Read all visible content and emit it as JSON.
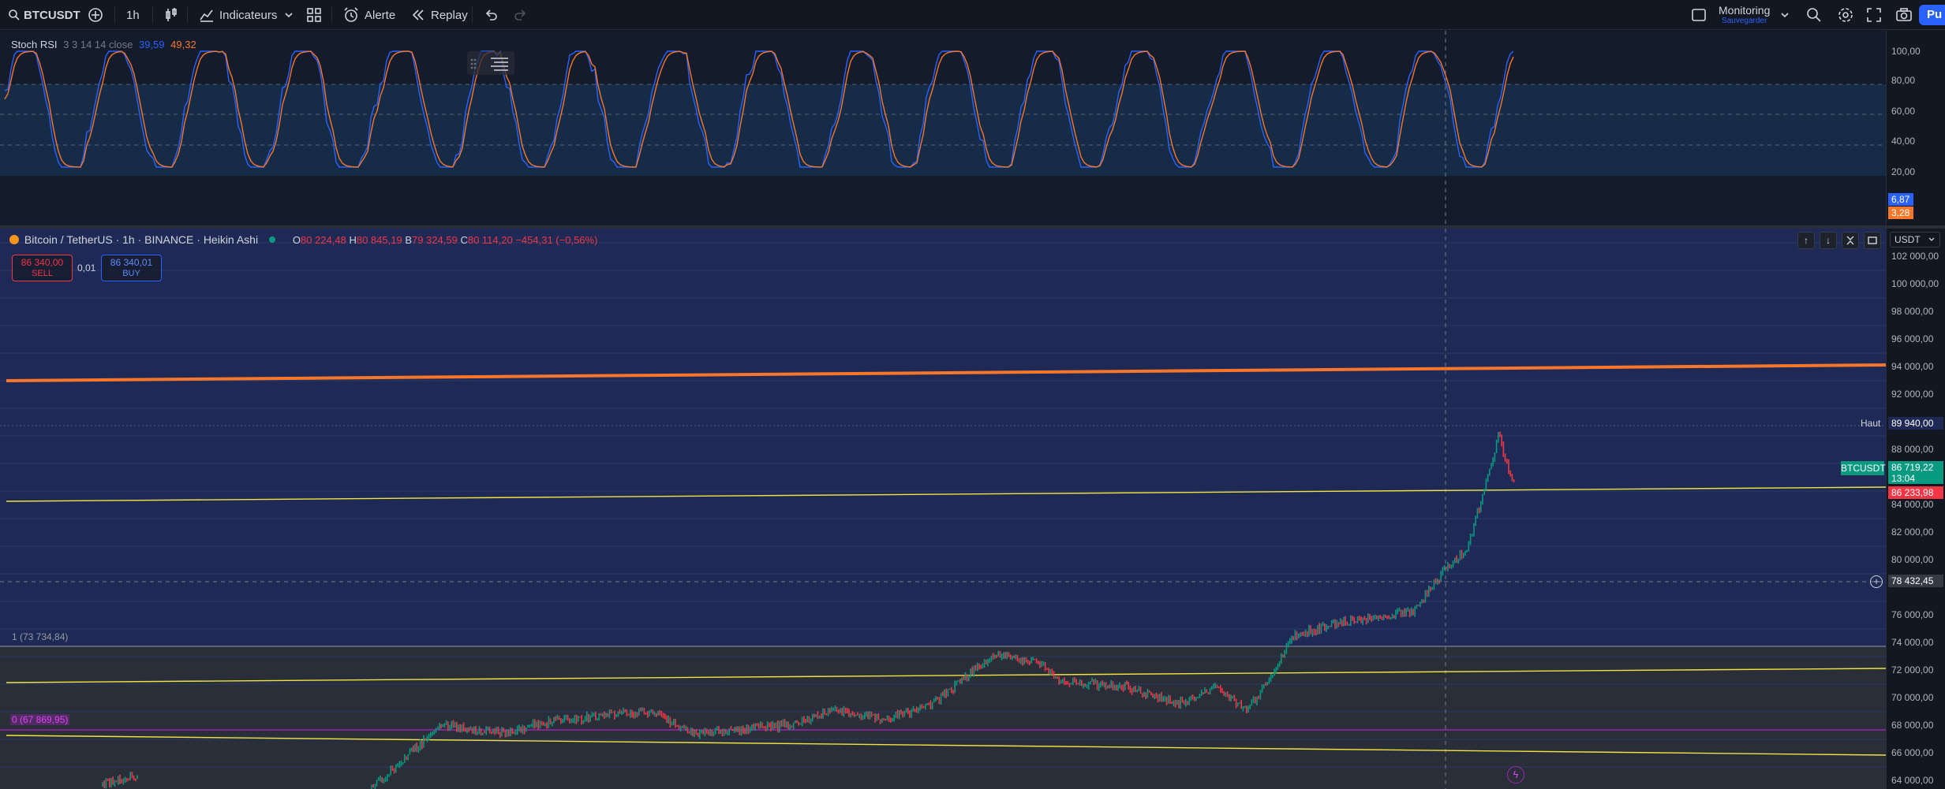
{
  "toolbar": {
    "symbol": "BTCUSDT",
    "interval": "1h",
    "indicators_label": "Indicateurs",
    "alert_label": "Alerte",
    "replay_label": "Replay",
    "layout_name": "Monitoring",
    "layout_status": "Sauvegarder",
    "publish_label": "Pu"
  },
  "rsi_pane": {
    "legend_name": "Stoch RSI",
    "legend_params": "3 3 14 14 close",
    "k_value": "39,59",
    "d_value": "49,32",
    "k_color": "#2962ff",
    "d_color": "#f7762a",
    "axis_labels": [
      "100,00",
      "80,00",
      "60,00",
      "40,00",
      "20,00"
    ],
    "k_last_tag": "6,87",
    "d_last_tag": "3,28"
  },
  "main_pane": {
    "title": "Bitcoin / TetherUS · 1h · BINANCE · Heikin Ashi",
    "ohlc": {
      "o_label": "O",
      "o": "80 224,48",
      "h_label": "H",
      "h": "80 845,19",
      "b_label": "B",
      "b": "79 324,59",
      "c_label": "C",
      "c": "80 114,20",
      "change": "−454,31 (−0,56%)"
    },
    "sell_price": "86 340,00",
    "sell_label": "SELL",
    "spread": "0,01",
    "buy_price": "86 340,01",
    "buy_label": "BUY",
    "currency": "USDT",
    "axis_labels": [
      "102 000,00",
      "100 000,00",
      "98 000,00",
      "96 000,00",
      "94 000,00",
      "92 000,00",
      "88 000,00",
      "84 000,00",
      "82 000,00",
      "80 000,00",
      "76 000,00",
      "74 000,00",
      "72 000,00",
      "70 000,00",
      "68 000,00",
      "66 000,00",
      "64 000,00"
    ],
    "high_label": "Haut",
    "high_value": "89 940,00",
    "symbol_tag": "BTCUSDT",
    "last_price": "86 719,22",
    "countdown": "13:04",
    "bid_price": "86 233,98",
    "crosshair_price": "78 432,45",
    "fib_level_1": "1 (73 734,84)",
    "fib_level_0": "0 (67 869,95)",
    "up_color": "#089981",
    "down_color": "#f23645",
    "trendline_color": "#f7762a"
  }
}
